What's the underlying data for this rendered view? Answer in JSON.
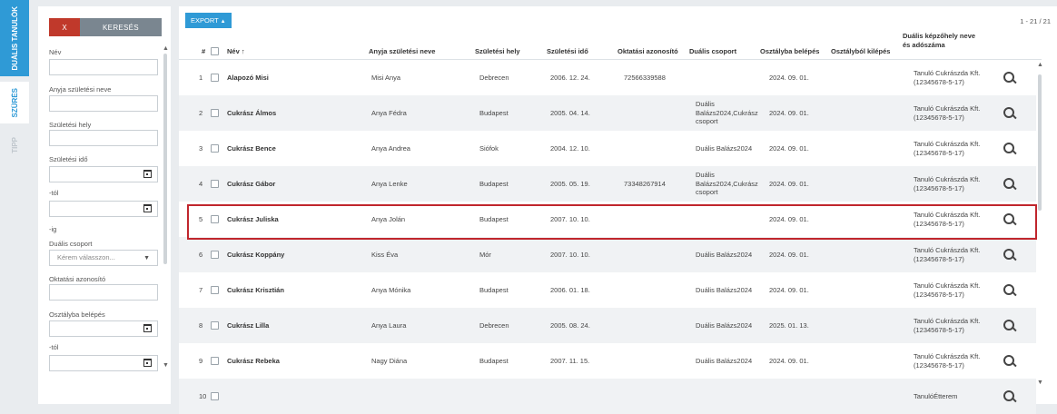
{
  "tabs": {
    "dual": "DUÁLIS TANULÓK",
    "szures": "SZŰRÉS",
    "tipp": "TIPP"
  },
  "filter": {
    "clear_label": "X",
    "search_label": "KERESÉS",
    "nev": "Név",
    "anyja": "Anyja születési neve",
    "szulhely": "Születési hely",
    "szulido": "Születési idő",
    "tol": "-tól",
    "ig": "-ig",
    "dualis_csoport": "Duális csoport",
    "select_placeholder": "Kérem válasszon...",
    "oktatasi": "Oktatási azonosító",
    "osztalyba": "Osztályba belépés",
    "tol2": "-tól"
  },
  "toolbar": {
    "export_label": "EXPORT",
    "export_caret": "▲",
    "paging": "1 - 21 / 21"
  },
  "table": {
    "headers": {
      "num": "#",
      "name": "Név ↑",
      "mother": "Anyja születési neve",
      "place": "Születési hely",
      "date": "Születési idő",
      "eid": "Oktatási azonosító",
      "group": "Duális csoport",
      "enter": "Osztályba belépés",
      "exit": "Osztályból kilépés",
      "company": "Duális képzőhely neve és adószáma"
    },
    "rows": [
      {
        "num": "1",
        "name": "Alapozó Misi",
        "mother": "Misi Anya",
        "place": "Debrecen",
        "date": "2006. 12. 24.",
        "eid": "72566339588",
        "group": "",
        "enter": "2024. 09. 01.",
        "company": "Tanuló Cukrászda Kft. (12345678-5-17)"
      },
      {
        "num": "2",
        "name": "Cukrász Álmos",
        "mother": "Anya Fédra",
        "place": "Budapest",
        "date": "2005. 04. 14.",
        "eid": "",
        "group": "Duális Balázs2024,Cukrász csoport",
        "enter": "2024. 09. 01.",
        "company": "Tanuló Cukrászda Kft. (12345678-5-17)"
      },
      {
        "num": "3",
        "name": "Cukrász Bence",
        "mother": "Anya Andrea",
        "place": "Siófok",
        "date": "2004. 12. 10.",
        "eid": "",
        "group": "Duális Balázs2024",
        "enter": "2024. 09. 01.",
        "company": "Tanuló Cukrászda Kft. (12345678-5-17)"
      },
      {
        "num": "4",
        "name": "Cukrász Gábor",
        "mother": "Anya Lenke",
        "place": "Budapest",
        "date": "2005. 05. 19.",
        "eid": "73348267914",
        "group": "Duális Balázs2024,Cukrász csoport",
        "enter": "2024. 09. 01.",
        "company": "Tanuló Cukrászda Kft. (12345678-5-17)"
      },
      {
        "num": "5",
        "name": "Cukrász Juliska",
        "mother": "Anya Jolán",
        "place": "Budapest",
        "date": "2007. 10. 10.",
        "eid": "",
        "group": "",
        "enter": "2024. 09. 01.",
        "company": "Tanuló Cukrászda Kft. (12345678-5-17)"
      },
      {
        "num": "6",
        "name": "Cukrász Koppány",
        "mother": "Kiss Éva",
        "place": "Mór",
        "date": "2007. 10. 10.",
        "eid": "",
        "group": "Duális Balázs2024",
        "enter": "2024. 09. 01.",
        "company": "Tanuló Cukrászda Kft. (12345678-5-17)"
      },
      {
        "num": "7",
        "name": "Cukrász Krisztián",
        "mother": "Anya Mónika",
        "place": "Budapest",
        "date": "2006. 01. 18.",
        "eid": "",
        "group": "Duális Balázs2024",
        "enter": "2024. 09. 01.",
        "company": "Tanuló Cukrászda Kft. (12345678-5-17)"
      },
      {
        "num": "8",
        "name": "Cukrász Lilla",
        "mother": "Anya Laura",
        "place": "Debrecen",
        "date": "2005. 08. 24.",
        "eid": "",
        "group": "Duális Balázs2024",
        "enter": "2025. 01. 13.",
        "company": "Tanuló Cukrászda Kft. (12345678-5-17)"
      },
      {
        "num": "9",
        "name": "Cukrász Rebeka",
        "mother": "Nagy Diána",
        "place": "Budapest",
        "date": "2007. 11. 15.",
        "eid": "",
        "group": "Duális Balázs2024",
        "enter": "2024. 09. 01.",
        "company": "Tanuló Cukrászda Kft. (12345678-5-17)"
      },
      {
        "num": "10",
        "name": "",
        "mother": "",
        "place": "",
        "date": "",
        "eid": "",
        "group": "",
        "enter": "",
        "company": "TanulóÉtterem"
      }
    ]
  },
  "colors": {
    "accent": "#2f9ad6",
    "danger": "#c0392b",
    "highlight": "#c0262d"
  },
  "icons": {
    "row_action": "search-icon",
    "date_picker": "calendar-icon"
  }
}
